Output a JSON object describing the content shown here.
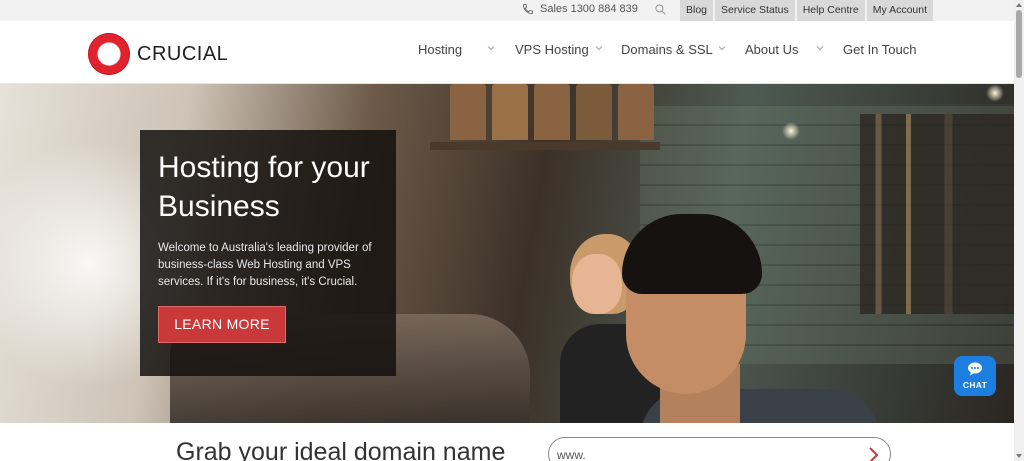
{
  "topbar": {
    "sales_label": "Sales 1300 884 839",
    "links": [
      {
        "label": "Blog"
      },
      {
        "label": "Service Status"
      },
      {
        "label": "Help Centre"
      },
      {
        "label": "My Account"
      }
    ]
  },
  "brand": {
    "name": "CRUCIAL",
    "accent_color": "#e0232d"
  },
  "nav": {
    "items": [
      {
        "label": "Hosting",
        "has_dropdown": true
      },
      {
        "label": "VPS Hosting",
        "has_dropdown": true
      },
      {
        "label": "Domains & SSL",
        "has_dropdown": true
      },
      {
        "label": "About Us",
        "has_dropdown": true
      },
      {
        "label": "Get In Touch",
        "has_dropdown": false
      }
    ]
  },
  "hero": {
    "title": "Hosting for your Business",
    "description": "Welcome to Australia's leading provider of business-class Web Hosting and VPS services. If it's for business, it's Crucial.",
    "cta_label": "LEARN MORE",
    "cta_color": "#c9393a"
  },
  "chat": {
    "label": "CHAT",
    "color": "#1c7fe0"
  },
  "domain_search": {
    "title": "Grab your ideal domain name",
    "input_value": "www."
  },
  "icons": {
    "phone": "phone-icon",
    "search": "search-icon",
    "chevron": "chevron-down-icon",
    "chat": "chat-bubble-icon",
    "go": "chevron-right-icon"
  }
}
